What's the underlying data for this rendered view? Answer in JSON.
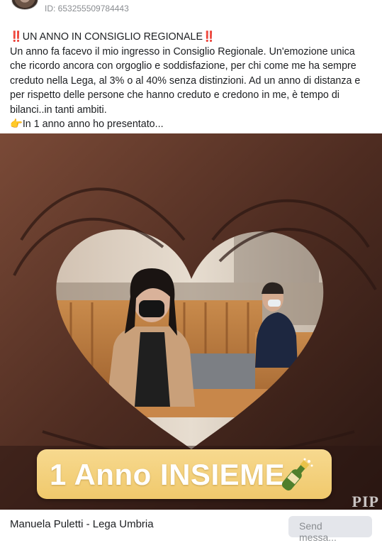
{
  "header": {
    "ad_id": "ID: 653255509784443"
  },
  "post": {
    "title": "‼️UN ANNO IN CONSIGLIO REGIONALE‼️",
    "body": "Un anno fa facevo il mio ingresso in Consiglio Regionale. Un'emozione unica che ricordo ancora con orgoglio e soddisfazione, per chi come me ha sempre creduto nella Lega, al 3% o al 40% senza distinzioni. Ad un anno di distanza e per rispetto delle persone che hanno creduto e credono in me, è tempo di bilanci..in tanti ambiti.",
    "bullet_icon": "pointing-hand-icon",
    "bullet_emoji": "👉",
    "bullet_text": "In 1 anno anno ho presentato..."
  },
  "media": {
    "banner_text": "1 Anno INSIEME",
    "banner_icon": "champagne-bottle-icon",
    "watermark": "PIP",
    "colors": {
      "banner": "#f2cd75",
      "banner_text": "#ffffff"
    }
  },
  "footer": {
    "page_name": "Manuela Puletti - Lega Umbria",
    "send_button_label": "Send messa..."
  }
}
